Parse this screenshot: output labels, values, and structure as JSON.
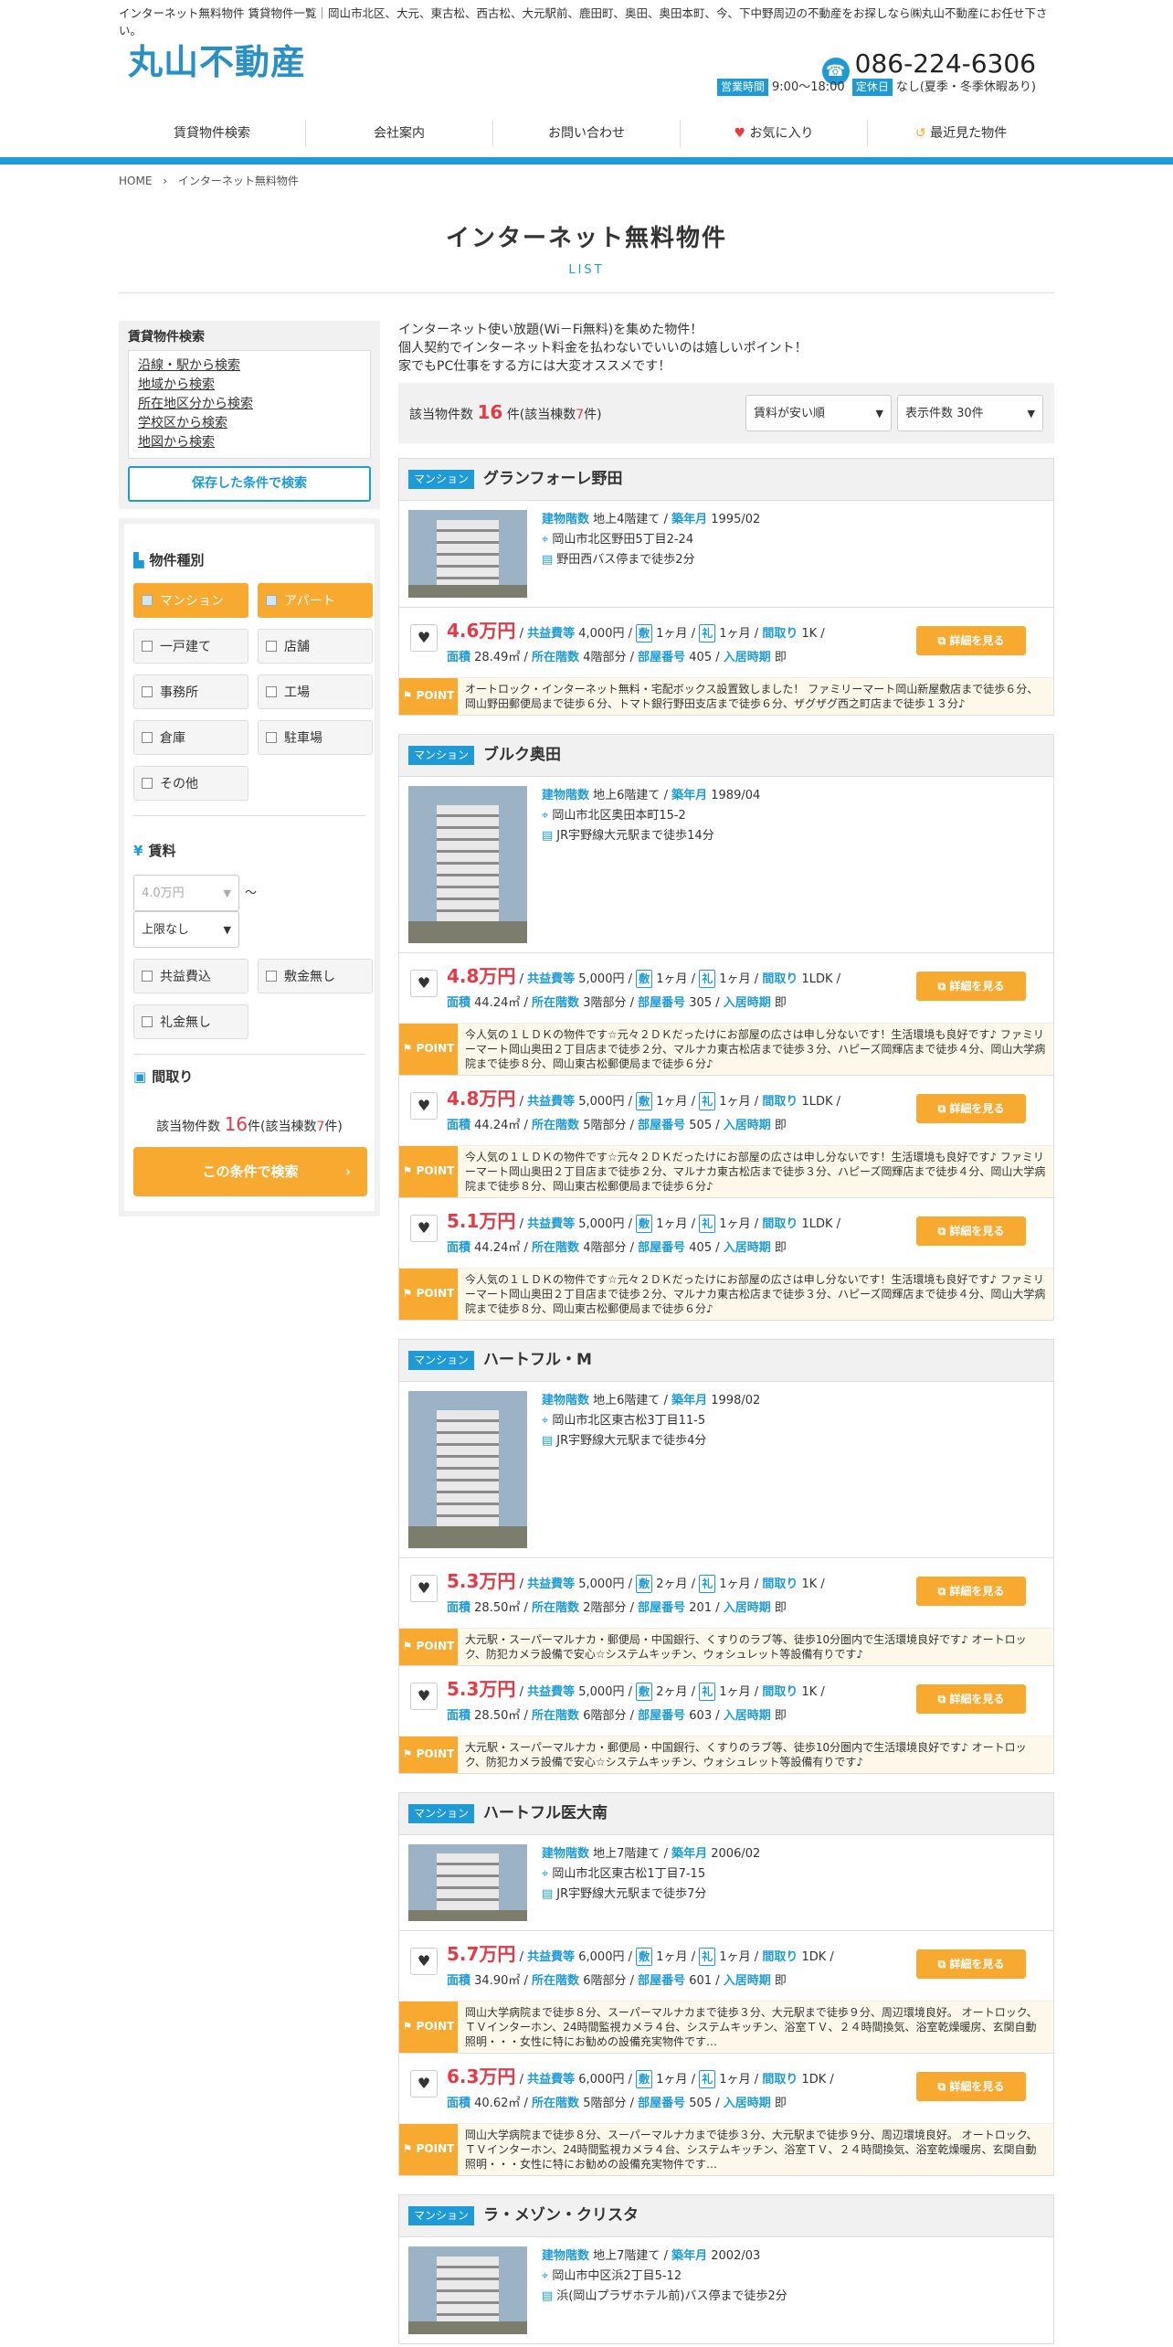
{
  "top_text": "インターネット無料物件 賃貸物件一覧｜岡山市北区、大元、東古松、西古松、大元駅前、鹿田町、奥田、奥田本町、今、下中野周辺の不動産をお探しなら㈱丸山不動産にお任せ下さい。",
  "logo": "丸山不動産",
  "phone": "086-224-6306",
  "hours_label": "営業時間",
  "hours_value": "9:00～18:00",
  "holiday_label": "定休日",
  "holiday_value": "なし(夏季・冬季休暇あり)",
  "nav": [
    "賃貸物件検索",
    "会社案内",
    "お問い合わせ",
    "お気に入り",
    "最近見た物件"
  ],
  "breadcrumb": {
    "home": "HOME",
    "current": "インターネット無料物件"
  },
  "page_title": "インターネット無料物件",
  "page_sub": "LIST",
  "sidebar": {
    "search_head": "賃貸物件検索",
    "links": [
      "沿線・駅から検索",
      "地域から検索",
      "所在地区分から検索",
      "学校区から検索",
      "地図から検索"
    ],
    "saved_btn": "保存した条件で検索",
    "type_head": "物件種別",
    "types": [
      "マンション",
      "アパート",
      "一戸建て",
      "店舗",
      "事務所",
      "工場",
      "倉庫",
      "駐車場",
      "その他"
    ],
    "rent_head": "賃料",
    "rent_min": "4.0万円",
    "rent_max": "上限なし",
    "tilde": "～",
    "rent_opts": [
      "共益費込",
      "敷金無し",
      "礼金無し"
    ],
    "layout_head": "間取り",
    "count_prefix": "該当物件数",
    "count": "16",
    "count_suffix": "件(該当棟数",
    "count_buildings": "7",
    "count_end": "件)",
    "search_btn": "この条件で検索"
  },
  "intro": [
    "インターネット使い放題(Wi－Fi無料)を集めた物件！",
    "個人契約でインターネット料金を払わないでいいのは嬉しいポイント！",
    "家でもPC仕事をする方には大変オススメです！"
  ],
  "result": {
    "prefix": "該当物件数",
    "count": "16",
    "mid": "件(該当棟数",
    "buildings": "7",
    "end": "件)",
    "sort": "賃料が安い順",
    "per_page": "表示件数 30件"
  },
  "labels": {
    "floors": "建物階数",
    "built": "築年月",
    "fee": "共益費等",
    "shiki": "敷",
    "rei": "礼",
    "layout": "間取り",
    "area": "面積",
    "floor": "所在階数",
    "room": "部屋番号",
    "move": "入居時期",
    "detail": "詳細を見る",
    "point": "POINT",
    "slash": "/"
  },
  "cards": [
    {
      "type": "マンション",
      "name": "グランフォーレ野田",
      "floors": "地上4階建て",
      "built": "1995/02",
      "address": "岡山市北区野田5丁目2-24",
      "access": "野田西バス停まで徒歩2分",
      "rooms": [
        {
          "rent": "4.6万円",
          "fee": "4,000円",
          "shiki": "1ヶ月",
          "rei": "1ヶ月",
          "layout": "1K",
          "area": "28.49㎡",
          "floor": "4階部分",
          "room": "405",
          "move": "即",
          "point": "オートロック・インターネット無料・宅配ボックス設置致しました！ ファミリーマート岡山新屋敷店まで徒歩６分、岡山野田郵便局まで徒歩６分、トマト銀行野田支店まで徒歩６分、ザグザグ西之町店まで徒歩１３分♪"
        }
      ]
    },
    {
      "type": "マンション",
      "name": "ブルク奥田",
      "floors": "地上6階建て",
      "built": "1989/04",
      "address": "岡山市北区奥田本町15-2",
      "access": "JR宇野線大元駅まで徒歩14分",
      "rooms": [
        {
          "rent": "4.8万円",
          "fee": "5,000円",
          "shiki": "1ヶ月",
          "rei": "1ヶ月",
          "layout": "1LDK",
          "area": "44.24㎡",
          "floor": "3階部分",
          "room": "305",
          "move": "即",
          "point": "今人気の１ＬＤＫの物件です☆元々２ＤＫだったけにお部屋の広さは申し分ないです！生活環境も良好です♪ ファミリーマート岡山奥田２丁目店まで徒歩２分、マルナカ東古松店まで徒歩３分、ハピーズ岡輝店まで徒歩４分、岡山大学病院まで徒歩８分、岡山東古松郵便局まで徒歩６分♪"
        },
        {
          "rent": "4.8万円",
          "fee": "5,000円",
          "shiki": "1ヶ月",
          "rei": "1ヶ月",
          "layout": "1LDK",
          "area": "44.24㎡",
          "floor": "5階部分",
          "room": "505",
          "move": "即",
          "point": "今人気の１ＬＤＫの物件です☆元々２ＤＫだったけにお部屋の広さは申し分ないです！生活環境も良好です♪ ファミリーマート岡山奥田２丁目店まで徒歩２分、マルナカ東古松店まで徒歩３分、ハピーズ岡輝店まで徒歩４分、岡山大学病院まで徒歩８分、岡山東古松郵便局まで徒歩６分♪"
        },
        {
          "rent": "5.1万円",
          "fee": "5,000円",
          "shiki": "1ヶ月",
          "rei": "1ヶ月",
          "layout": "1LDK",
          "area": "44.24㎡",
          "floor": "4階部分",
          "room": "405",
          "move": "即",
          "point": "今人気の１ＬＤＫの物件です☆元々２ＤＫだったけにお部屋の広さは申し分ないです！生活環境も良好です♪ ファミリーマート岡山奥田２丁目店まで徒歩２分、マルナカ東古松店まで徒歩３分、ハピーズ岡輝店まで徒歩４分、岡山大学病院まで徒歩８分、岡山東古松郵便局まで徒歩６分♪"
        }
      ]
    },
    {
      "type": "マンション",
      "name": "ハートフル・M",
      "floors": "地上6階建て",
      "built": "1998/02",
      "address": "岡山市北区東古松3丁目11-5",
      "access": "JR宇野線大元駅まで徒歩4分",
      "rooms": [
        {
          "rent": "5.3万円",
          "fee": "5,000円",
          "shiki": "2ヶ月",
          "rei": "1ヶ月",
          "layout": "1K",
          "area": "28.50㎡",
          "floor": "2階部分",
          "room": "201",
          "move": "即",
          "point": "大元駅・スーパーマルナカ・郵便局・中国銀行、くすりのラブ等、徒歩10分圏内で生活環境良好です♪ オートロック、防犯カメラ設備で安心☆システムキッチン、ウォシュレット等設備有りです♪"
        },
        {
          "rent": "5.3万円",
          "fee": "5,000円",
          "shiki": "2ヶ月",
          "rei": "1ヶ月",
          "layout": "1K",
          "area": "28.50㎡",
          "floor": "6階部分",
          "room": "603",
          "move": "即",
          "point": "大元駅・スーパーマルナカ・郵便局・中国銀行、くすりのラブ等、徒歩10分圏内で生活環境良好です♪ オートロック、防犯カメラ設備で安心☆システムキッチン、ウォシュレット等設備有りです♪"
        }
      ]
    },
    {
      "type": "マンション",
      "name": "ハートフル医大南",
      "floors": "地上7階建て",
      "built": "2006/02",
      "address": "岡山市北区東古松1丁目7-15",
      "access": "JR宇野線大元駅まで徒歩7分",
      "rooms": [
        {
          "rent": "5.7万円",
          "fee": "6,000円",
          "shiki": "1ヶ月",
          "rei": "1ヶ月",
          "layout": "1DK",
          "area": "34.90㎡",
          "floor": "6階部分",
          "room": "601",
          "move": "即",
          "point": "岡山大学病院まで徒歩８分、スーパーマルナカまで徒歩３分、大元駅まで徒歩９分、周辺環境良好。 オートロック、ＴＶインターホン、24時間監視カメラ４台、システムキッチン、浴室ＴＶ、２４時間換気、浴室乾燥暖房、玄関自動照明・・・女性に特にお勧めの設備充実物件です…"
        },
        {
          "rent": "6.3万円",
          "fee": "6,000円",
          "shiki": "1ヶ月",
          "rei": "1ヶ月",
          "layout": "1DK",
          "area": "40.62㎡",
          "floor": "5階部分",
          "room": "505",
          "move": "即",
          "point": "岡山大学病院まで徒歩８分、スーパーマルナカまで徒歩３分、大元駅まで徒歩９分、周辺環境良好。 オートロック、ＴＶインターホン、24時間監視カメラ４台、システムキッチン、浴室ＴＶ、２４時間換気、浴室乾燥暖房、玄関自動照明・・・女性に特にお勧めの設備充実物件です…"
        }
      ]
    },
    {
      "type": "マンション",
      "name": "ラ・メゾン・クリスタ",
      "floors": "地上7階建て",
      "built": "2002/03",
      "address": "岡山市中区浜2丁目5-12",
      "access": "浜(岡山プラザホテル前)バス停まで徒歩2分",
      "rooms": []
    }
  ]
}
